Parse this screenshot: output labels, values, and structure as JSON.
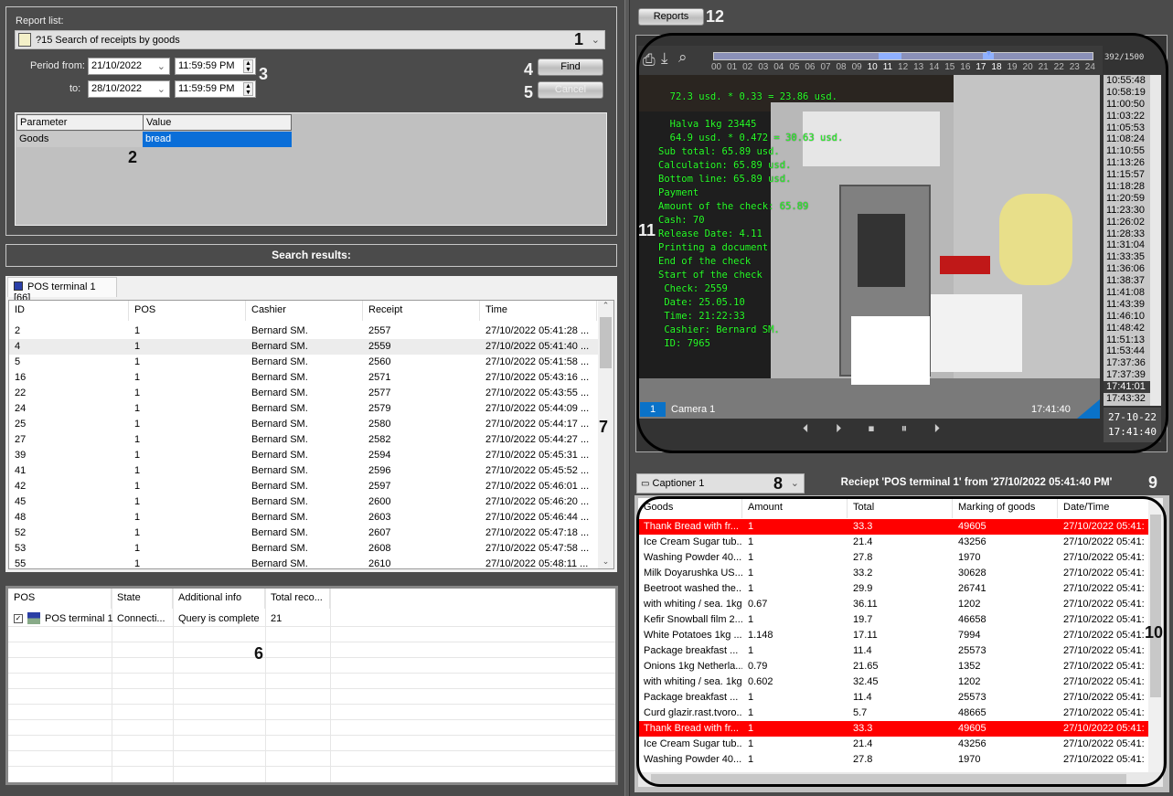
{
  "report": {
    "label": "Report list:",
    "selected": "?15 Search of receipts by goods",
    "period_from_label": "Period from:",
    "to_label": "to:",
    "from_date": "21/10/2022",
    "from_time": "11:59:59 PM",
    "to_date": "28/10/2022",
    "to_time": "11:59:59 PM",
    "find": "Find",
    "cancel": "Cancel"
  },
  "params": {
    "headers": [
      "Parameter",
      "Value"
    ],
    "rows": [
      [
        "Goods",
        "bread"
      ]
    ]
  },
  "search_results_title": "Search results:",
  "results_tab": "POS terminal 1 [66]",
  "results": {
    "headers": [
      "ID",
      "POS",
      "Cashier",
      "Receipt",
      "Time"
    ],
    "rows": [
      [
        "2",
        "1",
        "Bernard SM.",
        "2557",
        "27/10/2022 05:41:28 ..."
      ],
      [
        "4",
        "1",
        "Bernard SM.",
        "2559",
        "27/10/2022 05:41:40 ..."
      ],
      [
        "5",
        "1",
        "Bernard SM.",
        "2560",
        "27/10/2022 05:41:58 ..."
      ],
      [
        "16",
        "1",
        "Bernard SM.",
        "2571",
        "27/10/2022 05:43:16 ..."
      ],
      [
        "22",
        "1",
        "Bernard SM.",
        "2577",
        "27/10/2022 05:43:55 ..."
      ],
      [
        "24",
        "1",
        "Bernard SM.",
        "2579",
        "27/10/2022 05:44:09 ..."
      ],
      [
        "25",
        "1",
        "Bernard SM.",
        "2580",
        "27/10/2022 05:44:17 ..."
      ],
      [
        "27",
        "1",
        "Bernard SM.",
        "2582",
        "27/10/2022 05:44:27 ..."
      ],
      [
        "39",
        "1",
        "Bernard SM.",
        "2594",
        "27/10/2022 05:45:31 ..."
      ],
      [
        "41",
        "1",
        "Bernard SM.",
        "2596",
        "27/10/2022 05:45:52 ..."
      ],
      [
        "42",
        "1",
        "Bernard SM.",
        "2597",
        "27/10/2022 05:46:01 ..."
      ],
      [
        "45",
        "1",
        "Bernard SM.",
        "2600",
        "27/10/2022 05:46:20 ..."
      ],
      [
        "48",
        "1",
        "Bernard SM.",
        "2603",
        "27/10/2022 05:46:44 ..."
      ],
      [
        "52",
        "1",
        "Bernard SM.",
        "2607",
        "27/10/2022 05:47:18 ..."
      ],
      [
        "53",
        "1",
        "Bernard SM.",
        "2608",
        "27/10/2022 05:47:58 ..."
      ],
      [
        "55",
        "1",
        "Bernard SM.",
        "2610",
        "27/10/2022 05:48:11 ..."
      ]
    ],
    "selected_index": 1
  },
  "pos_status": {
    "headers": [
      "POS",
      "State",
      "Additional info",
      "Total reco..."
    ],
    "rows": [
      [
        "POS terminal 1",
        "Connecti...",
        "Query is complete",
        "21"
      ]
    ]
  },
  "reports_button": "Reports",
  "video": {
    "counter": "392/1500",
    "hours": [
      "00",
      "01",
      "02",
      "03",
      "04",
      "05",
      "06",
      "07",
      "08",
      "09",
      "10",
      "11",
      "12",
      "13",
      "14",
      "15",
      "16",
      "17",
      "18",
      "19",
      "20",
      "21",
      "22",
      "23",
      "24"
    ],
    "times": [
      "10:55:48",
      "10:58:19",
      "11:00:50",
      "11:03:22",
      "11:05:53",
      "11:08:24",
      "11:10:55",
      "11:13:26",
      "11:15:57",
      "11:18:28",
      "11:20:59",
      "11:23:30",
      "11:26:02",
      "11:28:33",
      "11:31:04",
      "11:33:35",
      "11:36:06",
      "11:38:37",
      "11:41:08",
      "11:43:39",
      "11:46:10",
      "11:48:42",
      "11:51:13",
      "11:53:44",
      "17:37:36",
      "17:37:39",
      "17:41:01",
      "17:43:32"
    ],
    "selected_time": "17:41:01",
    "camera_num": "1",
    "camera_name": "Camera 1",
    "timestamp": "17:41:40",
    "date": "27-10-22",
    "time": "17:41:40",
    "osd": [
      "  72.3 usd. * 0.33 = 23.86 usd.",
      "",
      "  Halva 1kg 23445",
      "  64.9 usd. * 0.472 = 30.63 usd.",
      "Sub total: 65.89 usd.",
      "Calculation: 65.89 usd.",
      "Bottom line: 65.89 usd.",
      "Payment",
      "Amount of the check: 65.89",
      "Cash: 70",
      "Release Date: 4.11",
      "Printing a document",
      "End of the check",
      "Start of the check",
      " Check: 2559",
      " Date: 25.05.10",
      " Time: 21:22:33",
      " Cashier: Bernard SM.",
      " ID: 7965"
    ]
  },
  "captioner": {
    "selected": "Captioner 1",
    "title": "Reciept 'POS terminal 1' from '27/10/2022 05:41:40 PM'"
  },
  "receipt": {
    "headers": [
      "Goods",
      "Amount",
      "Total",
      "Marking of goods",
      "Date/Time"
    ],
    "highlight_color": "#ff0000",
    "rows": [
      [
        "Thank Bread with fr...",
        "1",
        "33.3",
        "49605",
        "27/10/2022 05:41:",
        true
      ],
      [
        "Ice Cream Sugar tub...",
        "1",
        "21.4",
        "43256",
        "27/10/2022 05:41:",
        false
      ],
      [
        "Washing Powder 40...",
        "1",
        "27.8",
        "1970",
        "27/10/2022 05:41:",
        false
      ],
      [
        "Milk Doyarushka US...",
        "1",
        "33.2",
        "30628",
        "27/10/2022 05:41:",
        false
      ],
      [
        "Beetroot washed the...",
        "1",
        "29.9",
        "26741",
        "27/10/2022 05:41:",
        false
      ],
      [
        "with whiting / sea. 1kg",
        "0.67",
        "36.11",
        "1202",
        "27/10/2022 05:41:",
        false
      ],
      [
        "Kefir Snowball film 2....",
        "1",
        "19.7",
        "46658",
        "27/10/2022 05:41:",
        false
      ],
      [
        "White Potatoes 1kg ...",
        "1.148",
        "17.11",
        "7994",
        "27/10/2022 05:41:",
        false
      ],
      [
        "Package breakfast ...",
        "1",
        "11.4",
        "25573",
        "27/10/2022 05:41:",
        false
      ],
      [
        "Onions 1kg Netherla...",
        "0.79",
        "21.65",
        "1352",
        "27/10/2022 05:41:",
        false
      ],
      [
        "with whiting / sea. 1kg",
        "0.602",
        "32.45",
        "1202",
        "27/10/2022 05:41:",
        false
      ],
      [
        "Package breakfast ...",
        "1",
        "11.4",
        "25573",
        "27/10/2022 05:41:",
        false
      ],
      [
        "Curd glazir.rast.tvoro...",
        "1",
        "5.7",
        "48665",
        "27/10/2022 05:41:",
        false
      ],
      [
        "Thank Bread with fr...",
        "1",
        "33.3",
        "49605",
        "27/10/2022 05:41:",
        true
      ],
      [
        "Ice Cream Sugar tub...",
        "1",
        "21.4",
        "43256",
        "27/10/2022 05:41:",
        false
      ],
      [
        "Washing Powder 40...",
        "1",
        "27.8",
        "1970",
        "27/10/2022 05:41:",
        false
      ]
    ]
  },
  "annotations": [
    "1",
    "2",
    "3",
    "4",
    "5",
    "6",
    "7",
    "8",
    "9",
    "10",
    "11",
    "12"
  ]
}
